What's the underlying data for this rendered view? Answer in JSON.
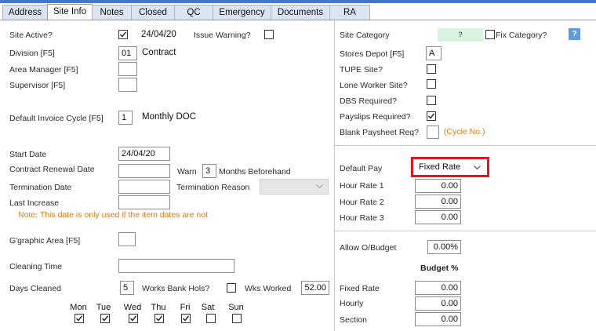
{
  "tabs": [
    "Address",
    "Site Info",
    "Notes",
    "Closed",
    "QC",
    "Emergency",
    "Documents",
    "RA"
  ],
  "left": {
    "site_active_label": "Site Active?",
    "site_active_date": "24/04/20",
    "issue_warning_label": "Issue Warning?",
    "division_label": "Division [F5]",
    "division_code": "01",
    "division_name": "Contract",
    "area_manager_label": "Area Manager [F5]",
    "area_manager_value": "",
    "supervisor_label": "Supervisor [F5]",
    "supervisor_value": "",
    "invoice_cycle_label": "Default Invoice Cycle [F5]",
    "invoice_cycle_code": "1",
    "invoice_cycle_name": "Monthly DOC",
    "start_date_label": "Start Date",
    "start_date_value": "24/04/20",
    "renewal_label": "Contract Renewal Date",
    "renewal_value": "",
    "warn_label": "Warn",
    "warn_value": "3",
    "months_label": "Months Beforehand",
    "termination_date_label": "Termination Date",
    "termination_date_value": "",
    "termination_reason_label": "Termination Reason",
    "termination_reason_value": "",
    "last_increase_label": "Last Increase",
    "last_increase_value": "",
    "note": "Note: This date is only used if the item dates are not",
    "graphic_area_label": "G'graphic Area [F5]",
    "graphic_area_value": "",
    "cleaning_time_label": "Cleaning Time",
    "cleaning_time_value": "",
    "days_cleaned_label": "Days Cleaned",
    "days_cleaned_value": "5",
    "bank_hols_label": "Works Bank Hols?",
    "wks_worked_label": "Wks Worked",
    "wks_worked_value": "52.00",
    "days": [
      {
        "label": "Mon",
        "checked": true
      },
      {
        "label": "Tue",
        "checked": true
      },
      {
        "label": "Wed",
        "checked": true
      },
      {
        "label": "Thu",
        "checked": true
      },
      {
        "label": "Fri",
        "checked": true
      },
      {
        "label": "Sat",
        "checked": false
      },
      {
        "label": "Sun",
        "checked": false
      }
    ]
  },
  "right": {
    "site_category_label": "Site Category",
    "site_category_value": "?",
    "fix_category_label": "Fix Category?",
    "help_label": "?",
    "stores_depot_label": "Stores Depot [F5]",
    "stores_depot_value": "A",
    "tupe_label": "TUPE Site?",
    "lone_worker_label": "Lone Worker Site?",
    "dbs_label": "DBS Required?",
    "payslips_label": "Payslips Required?",
    "blank_paysheet_label": "Blank Paysheet Req?",
    "cycle_no_label": "(Cycle No.)",
    "default_pay_label": "Default Pay",
    "default_pay_value": "Fixed Rate",
    "hour_rate_1_label": "Hour Rate 1",
    "hour_rate_1_value": "0.00",
    "hour_rate_2_label": "Hour Rate 2",
    "hour_rate_2_value": "0.00",
    "hour_rate_3_label": "Hour Rate 3",
    "hour_rate_3_value": "0.00",
    "allow_budget_label": "Allow O/Budget",
    "allow_budget_value": "0.00%",
    "budget_pct_label": "Budget %",
    "fixed_rate_label": "Fixed Rate",
    "fixed_rate_value": "0.00",
    "hourly_label": "Hourly",
    "hourly_value": "0.00",
    "section_label": "Section",
    "section_value": "0.00"
  },
  "checks": {
    "site_active": true,
    "issue_warning": false,
    "fix_category": false,
    "tupe": false,
    "lone_worker": false,
    "dbs": false,
    "payslips": true,
    "blank_paysheet": false,
    "bank_hols": false
  },
  "colors": {
    "accent": "#3d78d8",
    "highlight_border": "#e3141e",
    "note_orange": "#e07a10",
    "category_bg": "#d9f3e0",
    "help_bg": "#5b9de0"
  }
}
